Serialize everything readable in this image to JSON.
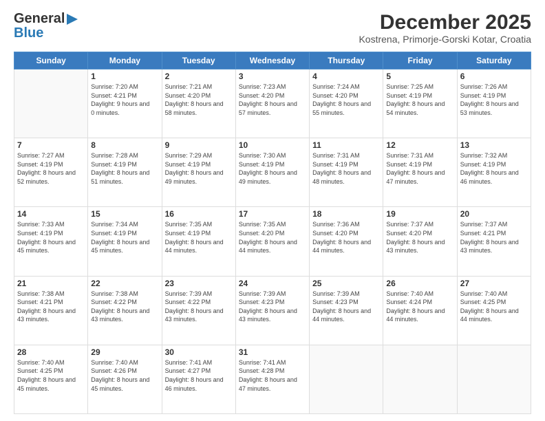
{
  "header": {
    "logo_general": "General",
    "logo_blue": "Blue",
    "month_title": "December 2025",
    "location": "Kostrena, Primorje-Gorski Kotar, Croatia"
  },
  "weekdays": [
    "Sunday",
    "Monday",
    "Tuesday",
    "Wednesday",
    "Thursday",
    "Friday",
    "Saturday"
  ],
  "weeks": [
    [
      {
        "day": "",
        "sunrise": "",
        "sunset": "",
        "daylight": ""
      },
      {
        "day": "1",
        "sunrise": "Sunrise: 7:20 AM",
        "sunset": "Sunset: 4:21 PM",
        "daylight": "Daylight: 9 hours and 0 minutes."
      },
      {
        "day": "2",
        "sunrise": "Sunrise: 7:21 AM",
        "sunset": "Sunset: 4:20 PM",
        "daylight": "Daylight: 8 hours and 58 minutes."
      },
      {
        "day": "3",
        "sunrise": "Sunrise: 7:23 AM",
        "sunset": "Sunset: 4:20 PM",
        "daylight": "Daylight: 8 hours and 57 minutes."
      },
      {
        "day": "4",
        "sunrise": "Sunrise: 7:24 AM",
        "sunset": "Sunset: 4:20 PM",
        "daylight": "Daylight: 8 hours and 55 minutes."
      },
      {
        "day": "5",
        "sunrise": "Sunrise: 7:25 AM",
        "sunset": "Sunset: 4:19 PM",
        "daylight": "Daylight: 8 hours and 54 minutes."
      },
      {
        "day": "6",
        "sunrise": "Sunrise: 7:26 AM",
        "sunset": "Sunset: 4:19 PM",
        "daylight": "Daylight: 8 hours and 53 minutes."
      }
    ],
    [
      {
        "day": "7",
        "sunrise": "Sunrise: 7:27 AM",
        "sunset": "Sunset: 4:19 PM",
        "daylight": "Daylight: 8 hours and 52 minutes."
      },
      {
        "day": "8",
        "sunrise": "Sunrise: 7:28 AM",
        "sunset": "Sunset: 4:19 PM",
        "daylight": "Daylight: 8 hours and 51 minutes."
      },
      {
        "day": "9",
        "sunrise": "Sunrise: 7:29 AM",
        "sunset": "Sunset: 4:19 PM",
        "daylight": "Daylight: 8 hours and 49 minutes."
      },
      {
        "day": "10",
        "sunrise": "Sunrise: 7:30 AM",
        "sunset": "Sunset: 4:19 PM",
        "daylight": "Daylight: 8 hours and 49 minutes."
      },
      {
        "day": "11",
        "sunrise": "Sunrise: 7:31 AM",
        "sunset": "Sunset: 4:19 PM",
        "daylight": "Daylight: 8 hours and 48 minutes."
      },
      {
        "day": "12",
        "sunrise": "Sunrise: 7:31 AM",
        "sunset": "Sunset: 4:19 PM",
        "daylight": "Daylight: 8 hours and 47 minutes."
      },
      {
        "day": "13",
        "sunrise": "Sunrise: 7:32 AM",
        "sunset": "Sunset: 4:19 PM",
        "daylight": "Daylight: 8 hours and 46 minutes."
      }
    ],
    [
      {
        "day": "14",
        "sunrise": "Sunrise: 7:33 AM",
        "sunset": "Sunset: 4:19 PM",
        "daylight": "Daylight: 8 hours and 45 minutes."
      },
      {
        "day": "15",
        "sunrise": "Sunrise: 7:34 AM",
        "sunset": "Sunset: 4:19 PM",
        "daylight": "Daylight: 8 hours and 45 minutes."
      },
      {
        "day": "16",
        "sunrise": "Sunrise: 7:35 AM",
        "sunset": "Sunset: 4:19 PM",
        "daylight": "Daylight: 8 hours and 44 minutes."
      },
      {
        "day": "17",
        "sunrise": "Sunrise: 7:35 AM",
        "sunset": "Sunset: 4:20 PM",
        "daylight": "Daylight: 8 hours and 44 minutes."
      },
      {
        "day": "18",
        "sunrise": "Sunrise: 7:36 AM",
        "sunset": "Sunset: 4:20 PM",
        "daylight": "Daylight: 8 hours and 44 minutes."
      },
      {
        "day": "19",
        "sunrise": "Sunrise: 7:37 AM",
        "sunset": "Sunset: 4:20 PM",
        "daylight": "Daylight: 8 hours and 43 minutes."
      },
      {
        "day": "20",
        "sunrise": "Sunrise: 7:37 AM",
        "sunset": "Sunset: 4:21 PM",
        "daylight": "Daylight: 8 hours and 43 minutes."
      }
    ],
    [
      {
        "day": "21",
        "sunrise": "Sunrise: 7:38 AM",
        "sunset": "Sunset: 4:21 PM",
        "daylight": "Daylight: 8 hours and 43 minutes."
      },
      {
        "day": "22",
        "sunrise": "Sunrise: 7:38 AM",
        "sunset": "Sunset: 4:22 PM",
        "daylight": "Daylight: 8 hours and 43 minutes."
      },
      {
        "day": "23",
        "sunrise": "Sunrise: 7:39 AM",
        "sunset": "Sunset: 4:22 PM",
        "daylight": "Daylight: 8 hours and 43 minutes."
      },
      {
        "day": "24",
        "sunrise": "Sunrise: 7:39 AM",
        "sunset": "Sunset: 4:23 PM",
        "daylight": "Daylight: 8 hours and 43 minutes."
      },
      {
        "day": "25",
        "sunrise": "Sunrise: 7:39 AM",
        "sunset": "Sunset: 4:23 PM",
        "daylight": "Daylight: 8 hours and 44 minutes."
      },
      {
        "day": "26",
        "sunrise": "Sunrise: 7:40 AM",
        "sunset": "Sunset: 4:24 PM",
        "daylight": "Daylight: 8 hours and 44 minutes."
      },
      {
        "day": "27",
        "sunrise": "Sunrise: 7:40 AM",
        "sunset": "Sunset: 4:25 PM",
        "daylight": "Daylight: 8 hours and 44 minutes."
      }
    ],
    [
      {
        "day": "28",
        "sunrise": "Sunrise: 7:40 AM",
        "sunset": "Sunset: 4:25 PM",
        "daylight": "Daylight: 8 hours and 45 minutes."
      },
      {
        "day": "29",
        "sunrise": "Sunrise: 7:40 AM",
        "sunset": "Sunset: 4:26 PM",
        "daylight": "Daylight: 8 hours and 45 minutes."
      },
      {
        "day": "30",
        "sunrise": "Sunrise: 7:41 AM",
        "sunset": "Sunset: 4:27 PM",
        "daylight": "Daylight: 8 hours and 46 minutes."
      },
      {
        "day": "31",
        "sunrise": "Sunrise: 7:41 AM",
        "sunset": "Sunset: 4:28 PM",
        "daylight": "Daylight: 8 hours and 47 minutes."
      },
      {
        "day": "",
        "sunrise": "",
        "sunset": "",
        "daylight": ""
      },
      {
        "day": "",
        "sunrise": "",
        "sunset": "",
        "daylight": ""
      },
      {
        "day": "",
        "sunrise": "",
        "sunset": "",
        "daylight": ""
      }
    ]
  ]
}
